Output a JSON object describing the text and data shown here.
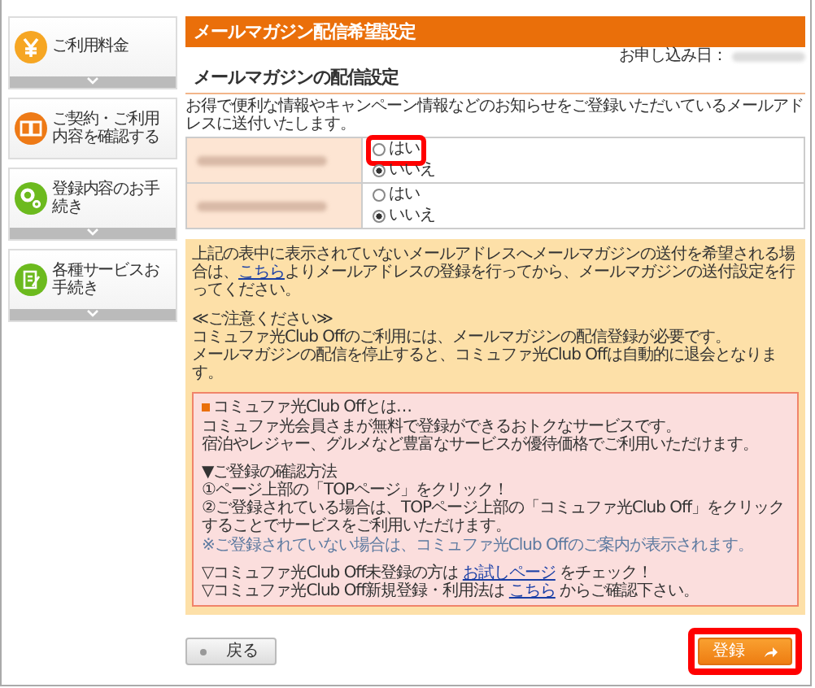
{
  "sidebar": {
    "items": [
      {
        "label": "ご利用料金",
        "kind": "yen",
        "expandable": true
      },
      {
        "label": "ご契約・ご利用内容を確認する",
        "kind": "book",
        "expandable": false
      },
      {
        "label": "登録内容のお手続き",
        "kind": "gears",
        "expandable": true
      },
      {
        "label": "各種サービスお手続き",
        "kind": "memo",
        "expandable": true
      }
    ]
  },
  "main": {
    "title": "メールマガジン配信希望設定",
    "applied_label": "お申し込み日：",
    "section_title": "メールマガジンの配信設定",
    "intro": "お得で便利な情報やキャンペーン情報などのお知らせをご登録いただいているメールアドレスに送付いたします。",
    "email_rows": [
      {
        "options": [
          {
            "label": "はい",
            "selected": false,
            "highlighted": true
          },
          {
            "label": "いいえ",
            "selected": true,
            "highlighted": false
          }
        ]
      },
      {
        "options": [
          {
            "label": "はい",
            "selected": false,
            "highlighted": false
          },
          {
            "label": "いいえ",
            "selected": true,
            "highlighted": false
          }
        ]
      }
    ],
    "notice": {
      "blocks": [
        [
          [
            {
              "text": "上記の表中に表示されていないメールアドレスへメールマガジンの送付を希望される場合は、"
            },
            {
              "text": "こちら",
              "link": true
            },
            {
              "text": "よりメールアドレスの登録を行ってから、メールマガジンの送付設定を行ってください。"
            }
          ]
        ],
        [
          [
            {
              "text": "≪ご注意ください≫"
            }
          ],
          [
            {
              "text": "コミュファ光Club Offのご利用には、メールマガジンの配信登録が必要です。"
            }
          ],
          [
            {
              "text": "メールマガジンの配信を停止すると、コミュファ光Club Offは自動的に退会となります。"
            }
          ]
        ]
      ]
    },
    "club_box": {
      "heading": "コミュファ光Club Offとは…",
      "blocks": [
        [
          {
            "kind": "text",
            "parts": [
              {
                "text": "コミュファ光会員さまが無料で登録ができるおトクなサービスです。"
              }
            ]
          },
          {
            "kind": "text",
            "parts": [
              {
                "text": "宿泊やレジャー、グルメなど豊富なサービスが優待価格でご利用いただけます。"
              }
            ]
          }
        ],
        [
          {
            "kind": "text",
            "parts": [
              {
                "text": "▼ご登録の確認方法"
              }
            ]
          },
          {
            "kind": "text",
            "parts": [
              {
                "text": "①ページ上部の「TOPページ」をクリック！"
              }
            ]
          },
          {
            "kind": "text",
            "parts": [
              {
                "text": "②ご登録されている場合は、TOPページ上部の「コミュファ光Club Off」をクリックすることでサービスをご利用いただけます。"
              }
            ]
          },
          {
            "kind": "note",
            "parts": [
              {
                "text": "※ご登録されていない場合は、コミュファ光Club Offのご案内が表示されます。"
              }
            ]
          }
        ],
        [
          {
            "kind": "text",
            "parts": [
              {
                "text": "▽コミュファ光Club Off未登録の方は "
              },
              {
                "text": "お試しページ",
                "link": true
              },
              {
                "text": " をチェック！"
              }
            ]
          },
          {
            "kind": "text",
            "parts": [
              {
                "text": "▽コミュファ光Club Off新規登録・利用法は "
              },
              {
                "text": "こちら",
                "link": true
              },
              {
                "text": " からご確認下さい。"
              }
            ]
          }
        ]
      ]
    },
    "buttons": [
      {
        "kind": "back",
        "label": "戻る",
        "highlighted": false
      },
      {
        "kind": "submit",
        "label": "登録",
        "highlighted": true
      }
    ]
  }
}
